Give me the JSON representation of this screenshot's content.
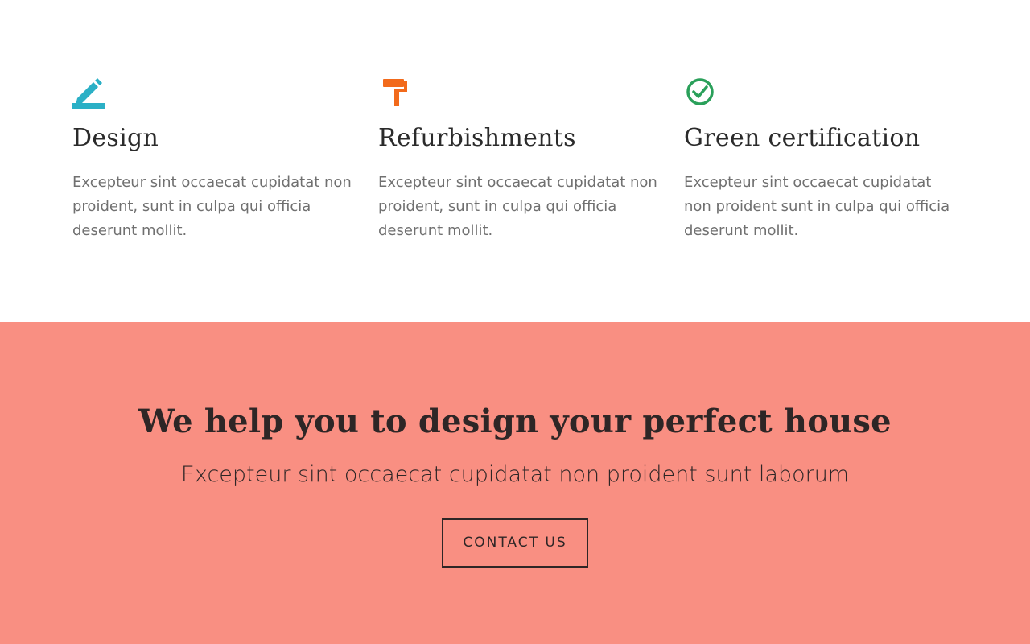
{
  "features": [
    {
      "icon": "pencil-icon",
      "icon_color": "#2bb0c6",
      "title": "Design",
      "text": "Excepteur sint occaecat cupidatat non proident, sunt in culpa qui officia deserunt mollit."
    },
    {
      "icon": "paint-roller-icon",
      "icon_color": "#f26a1b",
      "title": "Refurbishments",
      "text": "Excepteur sint occaecat cupidatat non proident, sunt in culpa qui officia deserunt mollit."
    },
    {
      "icon": "check-circle-icon",
      "icon_color": "#2aa05a",
      "title": "Green certification",
      "text": "Excepteur sint occaecat cupidatat non proident sunt in culpa qui officia deserunt mollit."
    }
  ],
  "cta": {
    "heading": "We help you to design your perfect house",
    "lead": "Excepteur sint occaecat cupidatat non proident sunt laborum",
    "button_label": "CONTACT US",
    "background_color": "#f98f82"
  }
}
